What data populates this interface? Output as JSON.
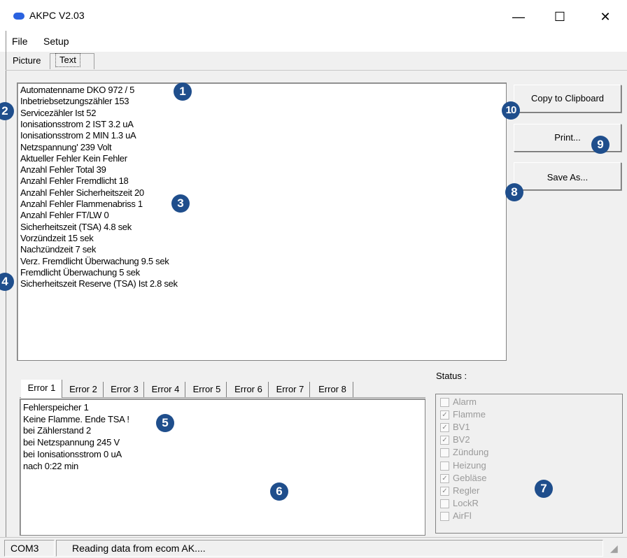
{
  "window": {
    "title": "AKPC V2.03",
    "minimize_glyph": "—",
    "maximize_glyph": "☐",
    "close_glyph": "✕",
    "app_icon": "blue-pill-icon"
  },
  "menu": {
    "items": [
      "File",
      "Setup"
    ]
  },
  "top_tabs": [
    "Picture",
    "Text"
  ],
  "main_text": [
    "Automatenname DKO 972 /  5",
    "Inbetriebsetzungszähler 153",
    "Servicezähler Ist 52",
    "Ionisationsstrom 2 IST 3.2 uA",
    "Ionisationsstrom 2 MIN 1.3 uA",
    "Netzspannung' 239 Volt",
    "Aktueller Fehler Kein Fehler",
    "Anzahl Fehler Total 39",
    "Anzahl Fehler Fremdlicht 18",
    "Anzahl Fehler Sicherheitszeit 20",
    "Anzahl Fehler Flammenabriss 1",
    "Anzahl Fehler FT/LW 0",
    "Sicherheitszeit (TSA) 4.8 sek",
    "Vorzündzeit 15 sek",
    "Nachzündzeit 7 sek",
    "Verz. Fremdlicht Überwachung 9.5 sek",
    "Fremdlicht Überwachung 5 sek",
    "Sicherheitszeit Reserve (TSA) Ist 2.8 sek"
  ],
  "buttons": {
    "copy": "Copy to Clipboard",
    "print": "Print...",
    "save_as": "Save As..."
  },
  "error_tabs": [
    "Error 1",
    "Error 2",
    "Error 3",
    "Error 4",
    "Error 5",
    "Error 6",
    "Error 7",
    "Error 8"
  ],
  "error_text": [
    "Fehlerspeicher 1",
    "Keine Flamme. Ende TSA !",
    "bei Zählerstand 2",
    "bei Netzspannung 245 V",
    "bei Ionisationsstrom 0 uA",
    "nach 0:22 min"
  ],
  "status": {
    "label": "Status :",
    "items": [
      {
        "label": "Alarm",
        "checked": false
      },
      {
        "label": "Flamme",
        "checked": true
      },
      {
        "label": "BV1",
        "checked": true
      },
      {
        "label": "BV2",
        "checked": true
      },
      {
        "label": "Zündung",
        "checked": false
      },
      {
        "label": "Heizung",
        "checked": false
      },
      {
        "label": "Gebläse",
        "checked": true
      },
      {
        "label": "Regler",
        "checked": true
      },
      {
        "label": "LockR",
        "checked": false
      },
      {
        "label": "AirFl",
        "checked": false
      }
    ]
  },
  "statusbar": {
    "port": "COM3",
    "message": "Reading data from ecom AK...."
  },
  "callouts": [
    "1",
    "2",
    "3",
    "4",
    "5",
    "6",
    "7",
    "8",
    "9",
    "10"
  ],
  "colors": {
    "callout": "#1f4e8c",
    "title_icon": "#2a62e0"
  }
}
